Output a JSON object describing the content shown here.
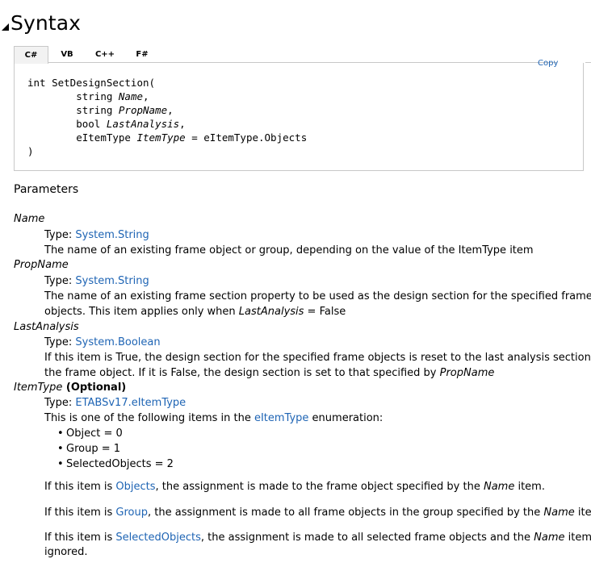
{
  "header": {
    "title": "Syntax"
  },
  "tabs": [
    "C#",
    "VB",
    "C++",
    "F#"
  ],
  "copy_label": "Copy",
  "code": {
    "line1": "int SetDesignSection(",
    "p1_type": "string ",
    "p1_name": "Name",
    "p1_end": ",",
    "p2_type": "string ",
    "p2_name": "PropName",
    "p2_end": ",",
    "p3_type": "bool ",
    "p3_name": "LastAnalysis",
    "p3_end": ",",
    "p4_type": "eItemType ",
    "p4_name": "ItemType",
    "p4_end": " = eItemType.Objects",
    "close": ")"
  },
  "parameters_heading": "Parameters",
  "params": {
    "name": {
      "title": "Name",
      "type_label": "Type: ",
      "type_link": "System.String",
      "desc": "The name of an existing frame object or group, depending on the value of the ItemType item"
    },
    "propname": {
      "title": "PropName",
      "type_label": "Type: ",
      "type_link": "System.String",
      "desc1": "The name of an existing frame section property to be used as the design section for the specified frame",
      "desc2_a": "objects. This item applies only when ",
      "desc2_it": "LastAnalysis",
      "desc2_b": " = False"
    },
    "lastanalysis": {
      "title": "LastAnalysis",
      "type_label": "Type: ",
      "type_link": "System.Boolean",
      "desc1": "If this item is True, the design section for the specified frame objects is reset to the last analysis section for",
      "desc2_a": "the frame object. If it is False, the design section is set to that specified by ",
      "desc2_it": "PropName"
    },
    "itemtype": {
      "title": "ItemType",
      "optional": " (Optional)",
      "type_label": "Type: ",
      "type_link": "ETABSv17.eItemType",
      "enum_a": "This is one of the following items in the ",
      "enum_link": "eItemType",
      "enum_b": " enumeration:",
      "bullets": [
        "Object = 0",
        "Group = 1",
        "SelectedObjects = 2"
      ],
      "n1_a": "If this item is ",
      "n1_link": "Objects",
      "n1_b": ", the assignment is made to the frame object specified by the ",
      "n1_it": "Name",
      "n1_c": " item.",
      "n2_a": "If this item is ",
      "n2_link": "Group",
      "n2_b": ", the assignment is made to all frame objects in the group specified by the ",
      "n2_it": "Name",
      "n2_c": " item.",
      "n3_a": "If this item is ",
      "n3_link": "SelectedObjects",
      "n3_b": ", the assignment is made to all selected frame objects and the ",
      "n3_it": "Name",
      "n3_c": " item is",
      "n3_d": "ignored."
    }
  },
  "colors": {
    "link": "#1e64b4",
    "border": "#c8c8c8",
    "active_tab_bg": "#f2f2f2"
  }
}
